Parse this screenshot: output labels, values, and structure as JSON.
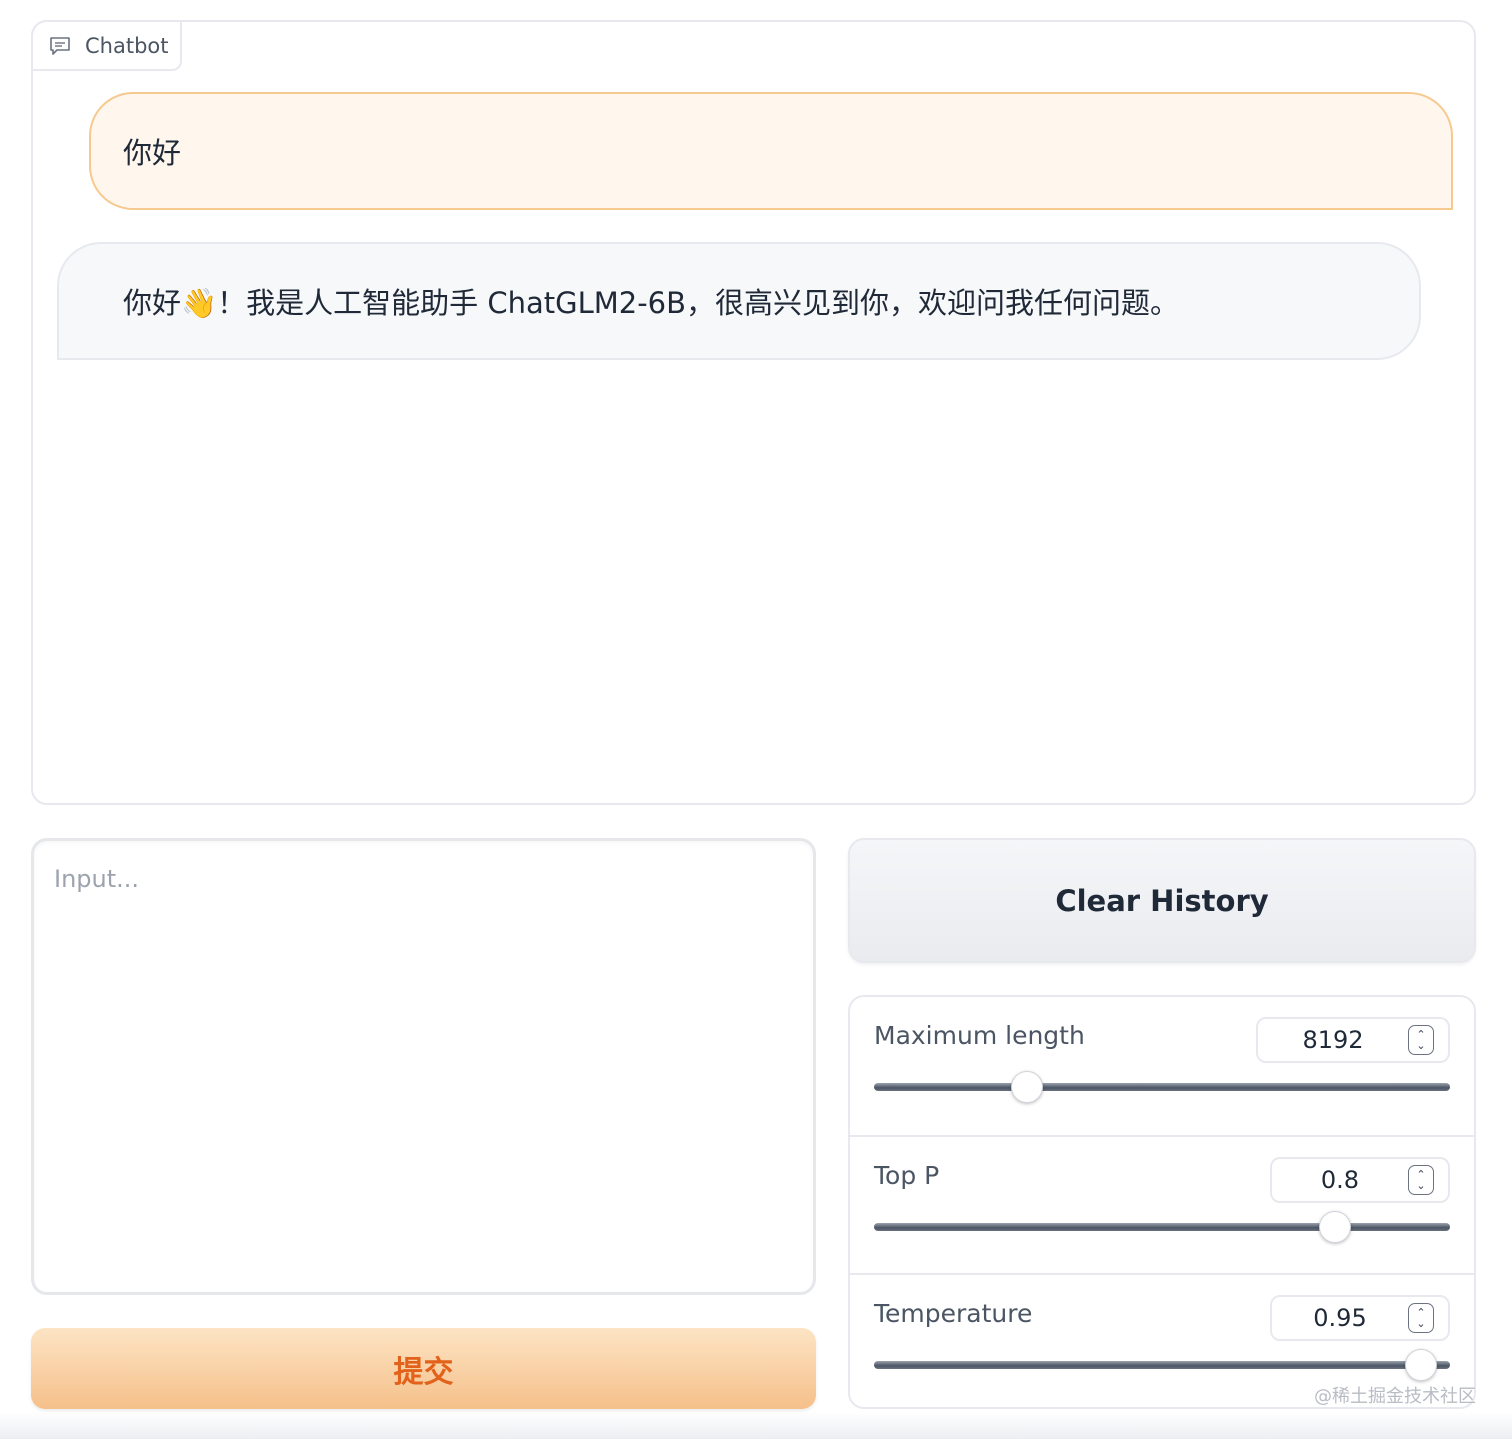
{
  "chatbot": {
    "label": "Chatbot",
    "messages": [
      {
        "role": "user",
        "text": "你好"
      },
      {
        "role": "bot",
        "text": "你好👋！我是人工智能助手 ChatGLM2-6B，很高兴见到你，欢迎问我任何问题。"
      }
    ]
  },
  "input": {
    "placeholder": "Input...",
    "value": ""
  },
  "submit": {
    "label": "提交"
  },
  "clear": {
    "label": "Clear History"
  },
  "params": [
    {
      "label": "Maximum length",
      "value": "8192",
      "fraction": 0.265
    },
    {
      "label": "Top P",
      "value": "0.8",
      "fraction": 0.8
    },
    {
      "label": "Temperature",
      "value": "0.95",
      "fraction": 0.95
    }
  ],
  "watermark": "@稀土掘金技术社区",
  "colors": {
    "accent": "#e2621b",
    "user_bubble": "#fff7ed",
    "user_border": "#f6c98f",
    "bot_bubble": "#f7f8fa"
  }
}
